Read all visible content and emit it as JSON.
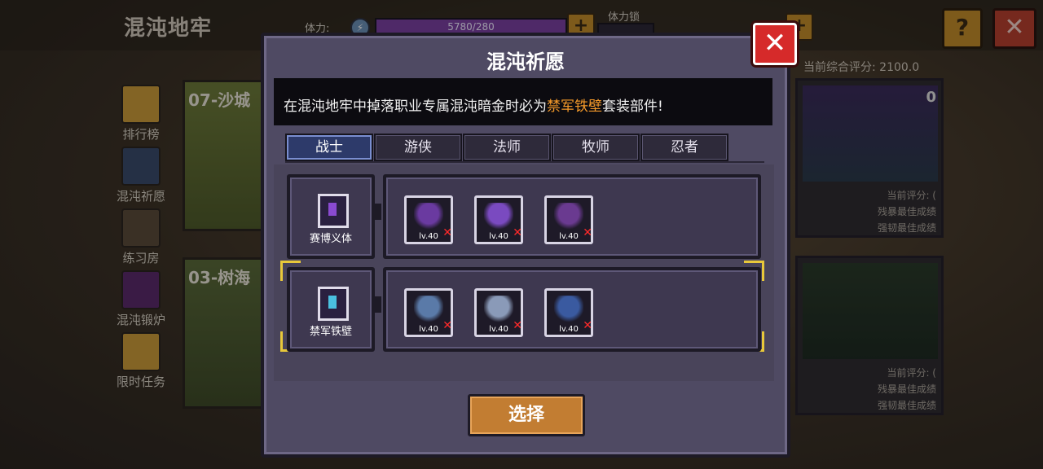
{
  "background": {
    "page_title": "混沌地牢",
    "stamina": {
      "label": "体力:",
      "value_text": "5780/280",
      "fill_fraction": 1.0
    },
    "stamina_lock": {
      "label": "体力锁"
    },
    "help_label": "?",
    "close_label": "✕",
    "menu": [
      {
        "label": "排行榜",
        "icon": "trophy-icon",
        "color": "#c99a3a"
      },
      {
        "label": "混沌祈愿",
        "icon": "tablet-icon",
        "color": "#3a4a6a"
      },
      {
        "label": "练习房",
        "icon": "shield-sword-icon",
        "color": "#5a4a3a"
      },
      {
        "label": "混沌锻炉",
        "icon": "cauldron-icon",
        "color": "#5a2a6a"
      },
      {
        "label": "限时任务",
        "icon": "gift-icon",
        "color": "#c99a3a"
      }
    ],
    "dungeons": [
      {
        "title": "07-沙城"
      },
      {
        "title": "03-树海"
      }
    ],
    "score_total": "当前综合评分: 2100.0",
    "right_cards": [
      {
        "title": "0",
        "lines": [
          "当前评分: (",
          "残暴最佳成绩",
          "强韧最佳成绩"
        ]
      },
      {
        "title": "",
        "lines": [
          "当前评分: (",
          "残暴最佳成绩",
          "强韧最佳成绩"
        ]
      }
    ]
  },
  "modal": {
    "title": "混沌祈愿",
    "close_label": "✕",
    "description_prefix": "在混沌地牢中掉落职业专属混沌暗金时必为",
    "description_highlight": "禁军铁壁",
    "description_suffix": "套装部件!",
    "tabs": [
      {
        "label": "战士",
        "active": true
      },
      {
        "label": "游侠",
        "active": false
      },
      {
        "label": "法师",
        "active": false
      },
      {
        "label": "牧师",
        "active": false
      },
      {
        "label": "忍者",
        "active": false
      }
    ],
    "sets": [
      {
        "name": "赛博义体",
        "selected": false,
        "icon_color": "#8a4ad0",
        "items": [
          {
            "icon": "purple-helmet-icon",
            "level": "lv.40",
            "missing": true,
            "color": "#6a3aa0"
          },
          {
            "icon": "purple-armor-icon",
            "level": "lv.40",
            "missing": true,
            "color": "#7a4ac0"
          },
          {
            "icon": "purple-boots-icon",
            "level": "lv.40",
            "missing": true,
            "color": "#6a3a90"
          }
        ]
      },
      {
        "name": "禁军铁壁",
        "selected": true,
        "icon_color": "#4ac0e0",
        "items": [
          {
            "icon": "steel-helmet-icon",
            "level": "lv.40",
            "missing": true,
            "color": "#5a7aa8"
          },
          {
            "icon": "steel-armor-icon",
            "level": "lv.40",
            "missing": true,
            "color": "#8a9ab8"
          },
          {
            "icon": "steel-boots-icon",
            "level": "lv.40",
            "missing": true,
            "color": "#3a5aa0"
          }
        ]
      }
    ],
    "select_button": "选择"
  },
  "colors": {
    "modal_bg": "#4f4a63",
    "highlight": "#f59a2a",
    "close_red": "#d62a2a",
    "select_orange": "#c27d32",
    "selection_yellow": "#e8c83a"
  }
}
